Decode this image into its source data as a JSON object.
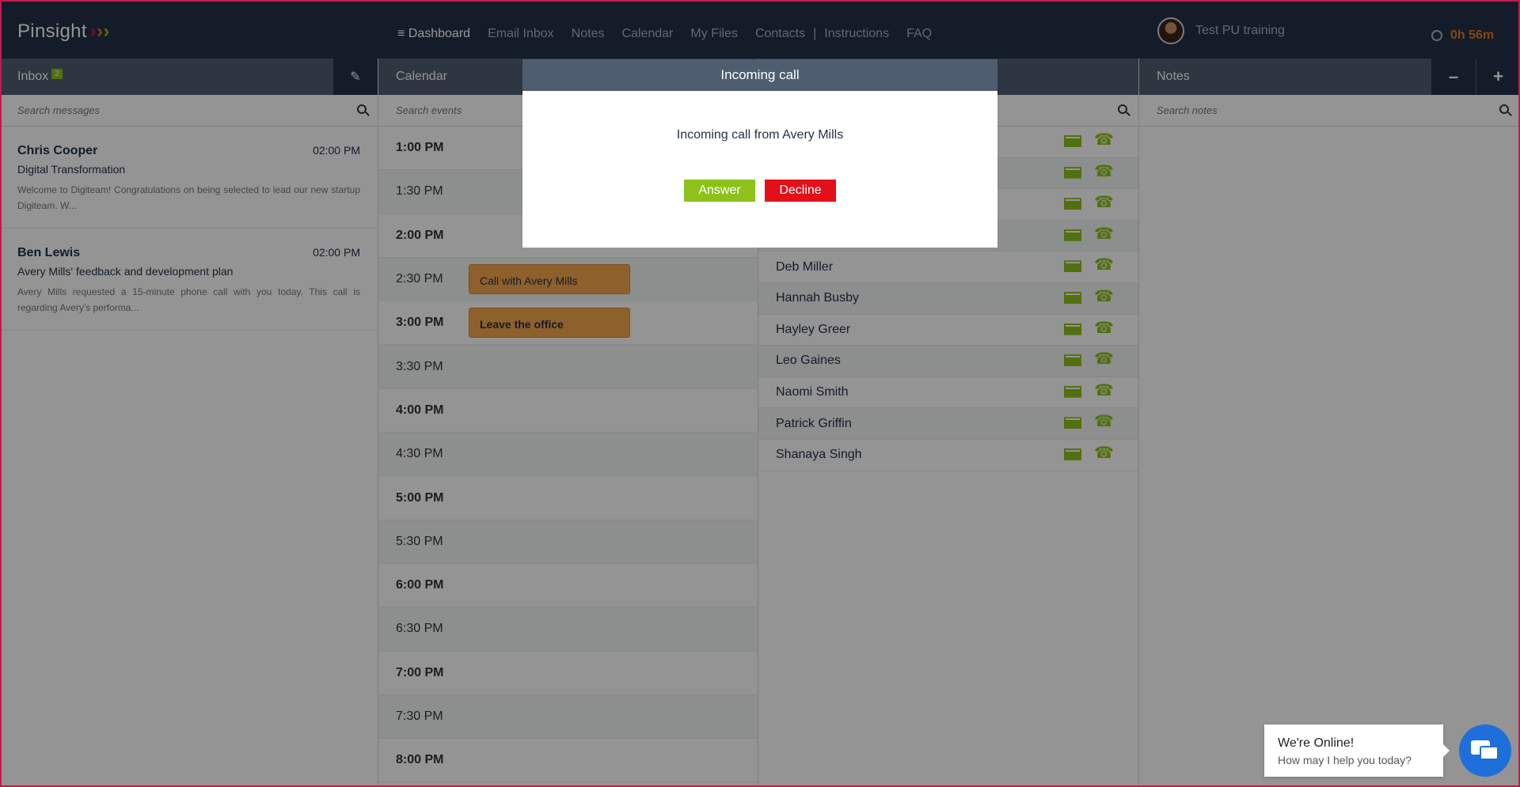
{
  "nav": {
    "logo": "Pinsight",
    "links": [
      {
        "label": "≡ Dashboard"
      },
      {
        "label": "Email Inbox"
      },
      {
        "label": "Notes"
      },
      {
        "label": "Calendar"
      },
      {
        "label": "My Files"
      },
      {
        "label": "Contacts"
      },
      {
        "label": "|"
      },
      {
        "label": "Instructions"
      },
      {
        "label": "FAQ"
      }
    ],
    "user_name": "Test PU training",
    "timer": "0h 56m"
  },
  "inbox": {
    "title": "Inbox",
    "badge": "2",
    "search_placeholder": "Search messages",
    "messages": [
      {
        "sender": "Chris Cooper",
        "time": "02:00 PM",
        "subject": "Digital Transformation",
        "snippet": "Welcome to Digiteam! Congratulations on being selected to lead our new startup Digiteam. W..."
      },
      {
        "sender": "Ben Lewis",
        "time": "02:00 PM",
        "subject": "Avery Mills' feedback and development plan",
        "snippet": "Avery Mills requested a 15-minute phone call with you today. This call is regarding Avery's performa..."
      }
    ]
  },
  "calendar": {
    "title": "Calendar",
    "search_placeholder": "Search events",
    "slots": [
      {
        "time": "1:00 PM"
      },
      {
        "time": "1:30 PM"
      },
      {
        "time": "2:00 PM"
      },
      {
        "time": "2:30 PM",
        "event": "Call with Avery Mills"
      },
      {
        "time": "3:00 PM",
        "event": "Leave the office"
      },
      {
        "time": "3:30 PM"
      },
      {
        "time": "4:00 PM"
      },
      {
        "time": "4:30 PM"
      },
      {
        "time": "5:00 PM"
      },
      {
        "time": "5:30 PM"
      },
      {
        "time": "6:00 PM"
      },
      {
        "time": "6:30 PM"
      },
      {
        "time": "7:00 PM"
      },
      {
        "time": "7:30 PM"
      },
      {
        "time": "8:00 PM"
      }
    ]
  },
  "contacts": {
    "names": [
      "",
      "",
      "",
      "",
      "Deb Miller",
      "Hannah Busby",
      "Hayley Greer",
      "Leo Gaines",
      "Naomi Smith",
      "Patrick Griffin",
      "Shanaya Singh"
    ]
  },
  "notes": {
    "title": "Notes",
    "search_placeholder": "Search notes"
  },
  "modal": {
    "title": "Incoming call",
    "message": "Incoming call from Avery Mills",
    "answer_label": "Answer",
    "decline_label": "Decline"
  },
  "chat": {
    "title": "We're Online!",
    "subtitle": "How may I help you today?"
  }
}
